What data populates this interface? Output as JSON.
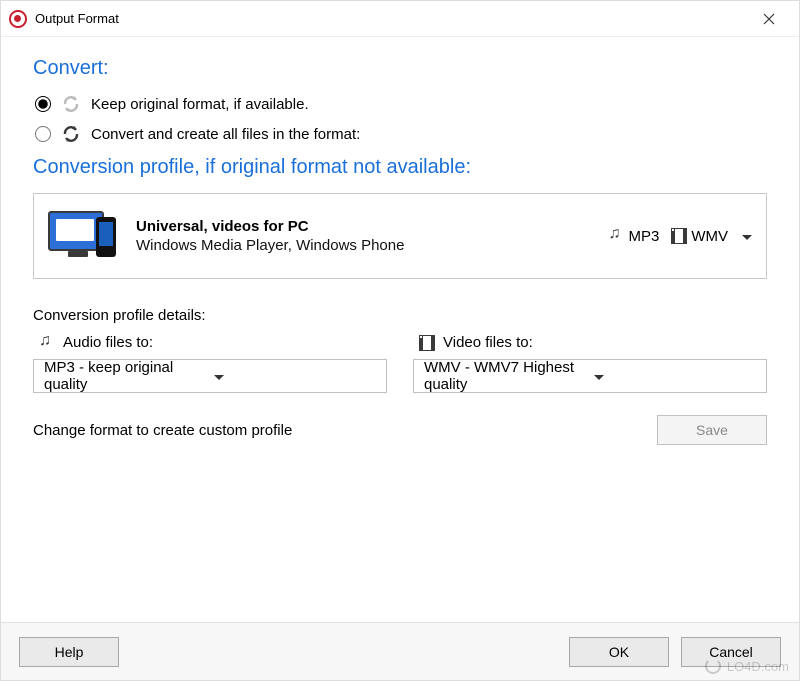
{
  "window": {
    "title": "Output Format"
  },
  "sections": {
    "convert_title": "Convert:",
    "profile_title": "Conversion profile, if original format not available:"
  },
  "radios": {
    "keep_original": "Keep original format, if available.",
    "convert_all": "Convert and create all files in the format:",
    "selected": "keep_original"
  },
  "profile": {
    "title": "Universal, videos for PC",
    "subtitle": "Windows Media Player, Windows Phone",
    "audio_tag": "MP3",
    "video_tag": "WMV"
  },
  "details": {
    "header": "Conversion profile details:",
    "audio_label": "Audio files to:",
    "video_label": "Video files to:",
    "audio_value": "MP3 - keep original quality",
    "video_value": "WMV - WMV7 Highest quality"
  },
  "custom": {
    "text": "Change format to create custom profile",
    "save_label": "Save"
  },
  "buttons": {
    "help": "Help",
    "ok": "OK",
    "cancel": "Cancel"
  },
  "watermark": "LO4D.com"
}
